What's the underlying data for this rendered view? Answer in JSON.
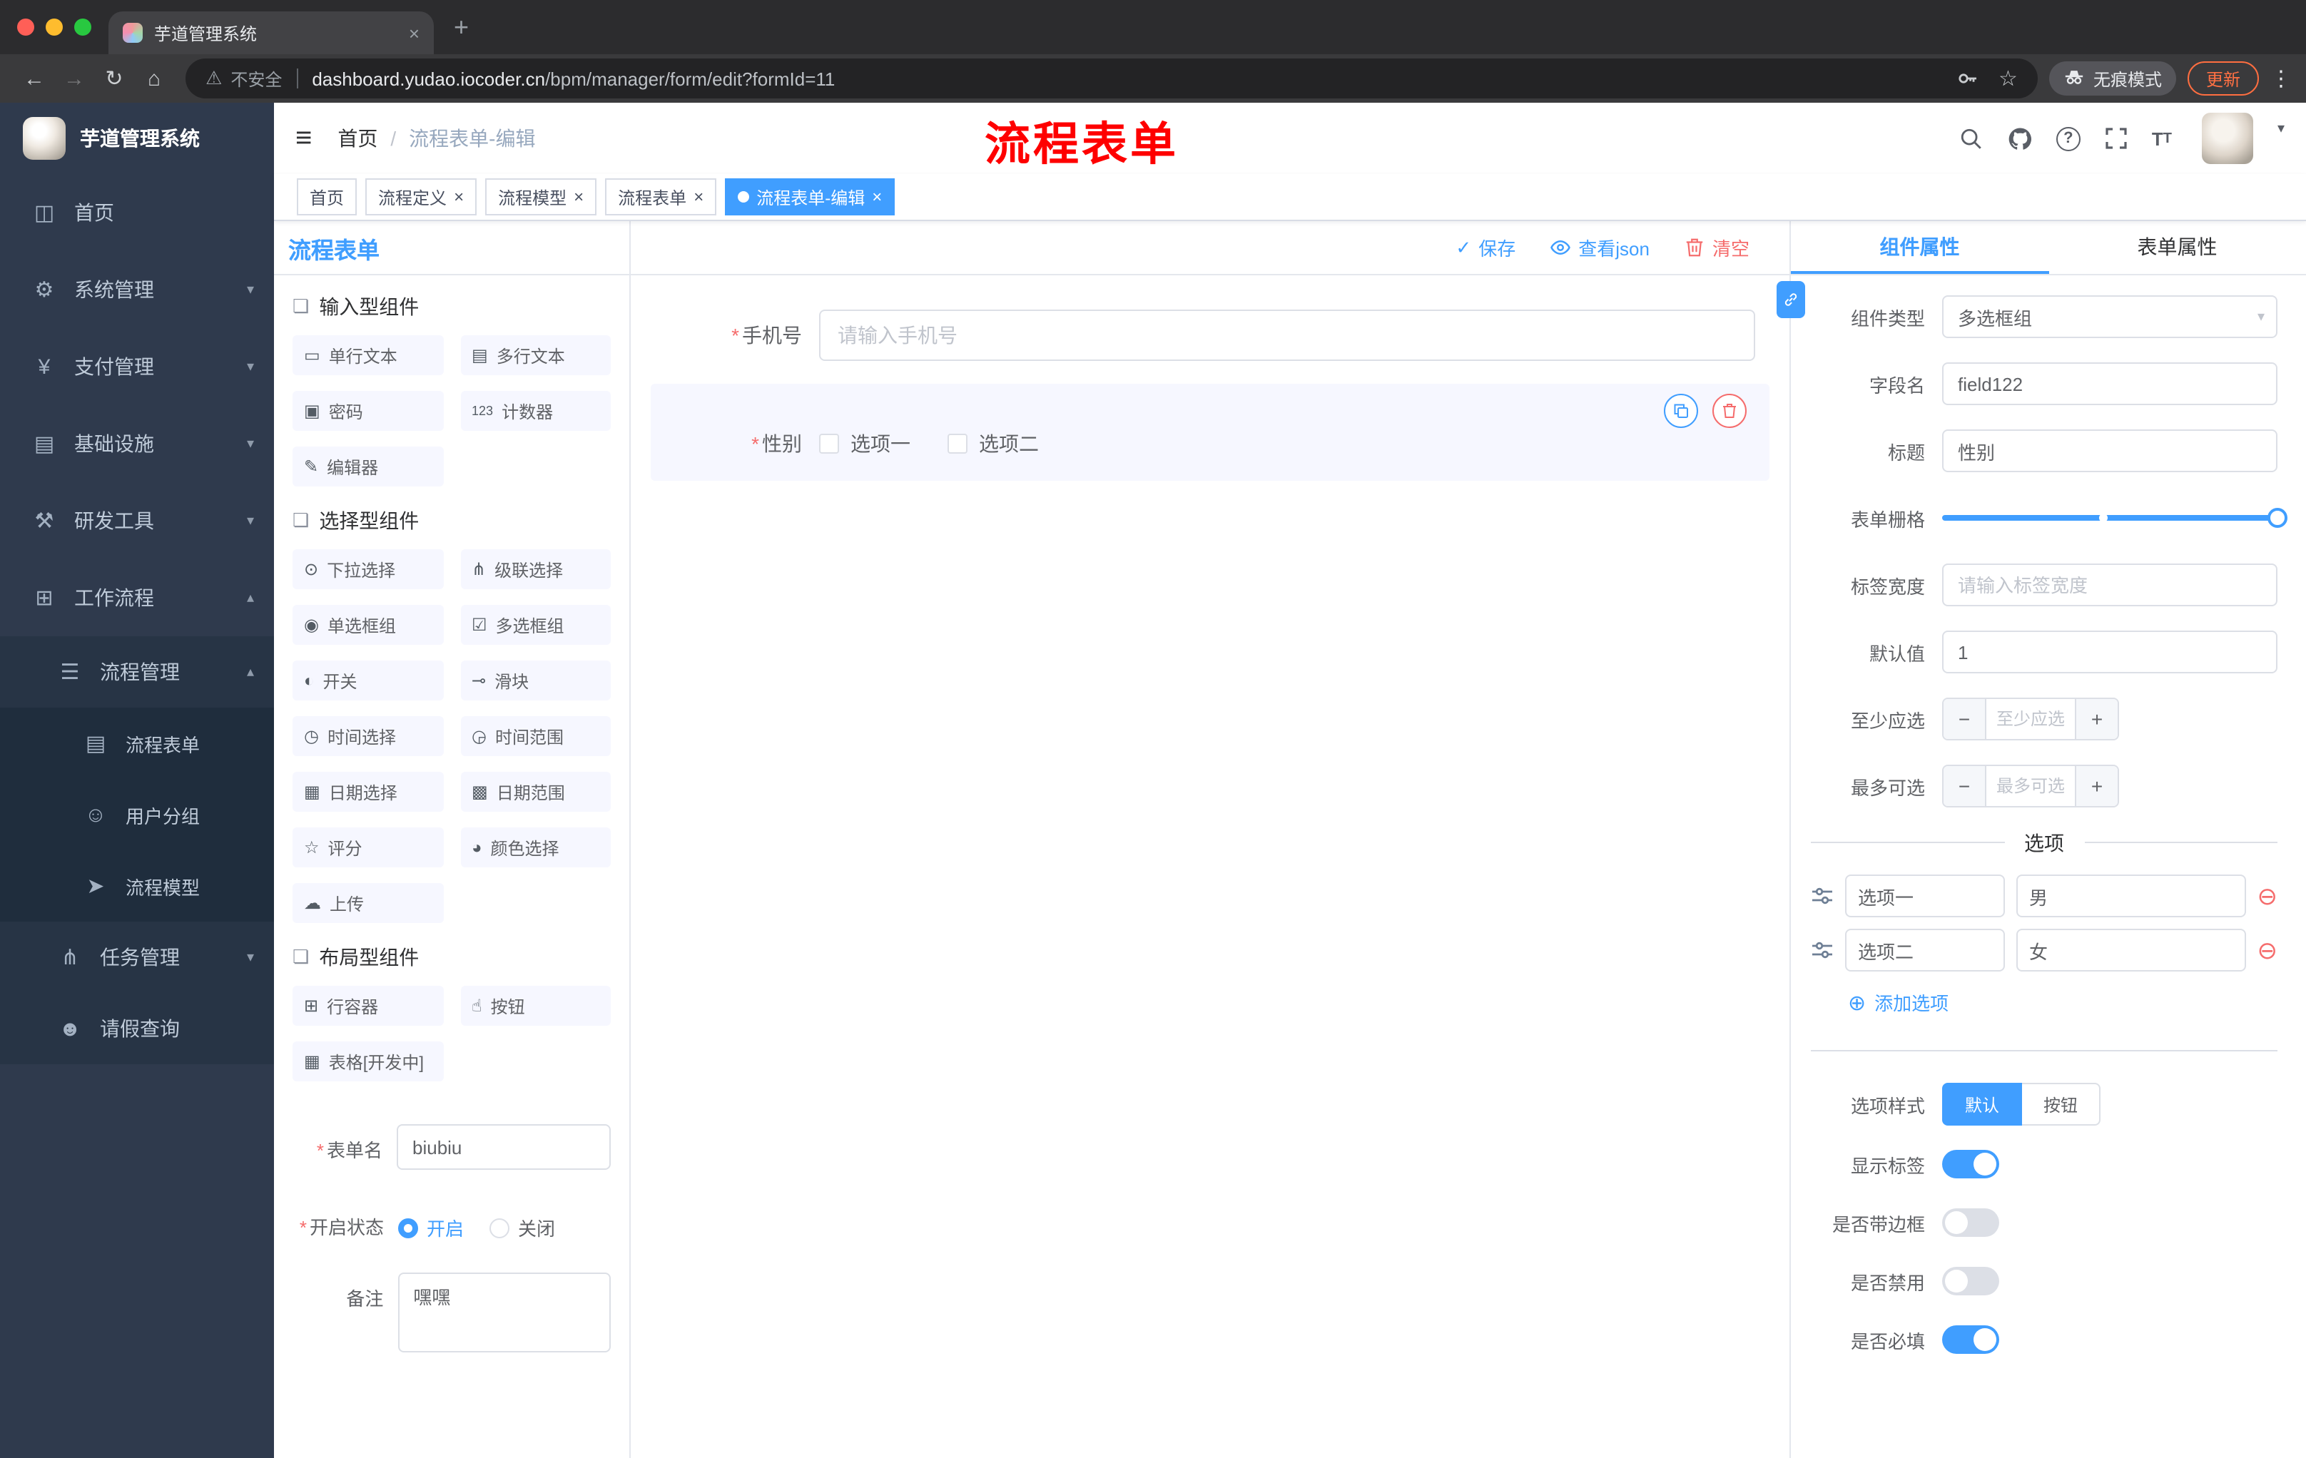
{
  "misc": {
    "required_mark": "*"
  },
  "browser": {
    "tab_title": "芋道管理系统",
    "new_tab": "+",
    "close_tab": "×",
    "back": "←",
    "forward": "→",
    "reload": "↻",
    "home": "⌂",
    "warning_icon": "⚠",
    "security_warning": "不安全",
    "url_domain": "dashboard.yudao.iocoder.cn",
    "url_path": "/bpm/manager/form/edit?formId=11",
    "bookmark_star": "☆",
    "incognito_label": "无痕模式",
    "update_label": "更新",
    "menu_dots": "⋮"
  },
  "sidebar": {
    "logo_title": "芋道管理系统",
    "items": [
      {
        "label": "首页",
        "icon": "◫",
        "chevron": ""
      },
      {
        "label": "系统管理",
        "icon": "⚙",
        "chevron": "▾"
      },
      {
        "label": "支付管理",
        "icon": "¥",
        "chevron": "▾"
      },
      {
        "label": "基础设施",
        "icon": "▤",
        "chevron": "▾"
      },
      {
        "label": "研发工具",
        "icon": "⚒",
        "chevron": "▾"
      },
      {
        "label": "工作流程",
        "icon": "⊞",
        "chevron": "▴"
      },
      {
        "label": "流程管理",
        "icon": "☰",
        "chevron": "▴"
      },
      {
        "label": "流程表单",
        "icon": "▤",
        "chevron": ""
      },
      {
        "label": "用户分组",
        "icon": "☺",
        "chevron": ""
      },
      {
        "label": "流程模型",
        "icon": "➤",
        "chevron": ""
      },
      {
        "label": "任务管理",
        "icon": "⋔",
        "chevron": "▾"
      },
      {
        "label": "请假查询",
        "icon": "☻",
        "chevron": ""
      }
    ]
  },
  "header": {
    "hamburger": "≡",
    "breadcrumb_home": "首页",
    "breadcrumb_sep": "/",
    "breadcrumb_current": "流程表单-编辑",
    "annotation": "流程表单",
    "help": "?",
    "font_icon_big": "T",
    "font_icon_small": "T",
    "avatar_caret": "▾"
  },
  "tags": {
    "close": "×",
    "items": [
      {
        "label": "首页",
        "closable": false,
        "active": false
      },
      {
        "label": "流程定义",
        "closable": true,
        "active": false
      },
      {
        "label": "流程模型",
        "closable": true,
        "active": false
      },
      {
        "label": "流程表单",
        "closable": true,
        "active": false
      },
      {
        "label": "流程表单-编辑",
        "closable": true,
        "active": true
      }
    ]
  },
  "designer": {
    "panel_title": "流程表单",
    "toolbar": {
      "save_icon": "✓",
      "save": "保存",
      "view_json": "查看json",
      "clear": "清空"
    },
    "groups": [
      {
        "title": "输入型组件",
        "icon": "❏",
        "items": [
          {
            "icon": "▭",
            "label": "单行文本"
          },
          {
            "icon": "▤",
            "label": "多行文本"
          },
          {
            "icon": "▣",
            "label": "密码"
          },
          {
            "icon": "123",
            "label": "计数器"
          },
          {
            "icon": "✎",
            "label": "编辑器"
          }
        ]
      },
      {
        "title": "选择型组件",
        "icon": "❏",
        "items": [
          {
            "icon": "⊙",
            "label": "下拉选择"
          },
          {
            "icon": "⋔",
            "label": "级联选择"
          },
          {
            "icon": "◉",
            "label": "单选框组"
          },
          {
            "icon": "☑",
            "label": "多选框组"
          },
          {
            "icon": "◐",
            "label": "开关"
          },
          {
            "icon": "⊸",
            "label": "滑块"
          },
          {
            "icon": "◷",
            "label": "时间选择"
          },
          {
            "icon": "◶",
            "label": "时间范围"
          },
          {
            "icon": "▦",
            "label": "日期选择"
          },
          {
            "icon": "▩",
            "label": "日期范围"
          },
          {
            "icon": "☆",
            "label": "评分"
          },
          {
            "icon": "◕",
            "label": "颜色选择"
          },
          {
            "icon": "☁",
            "label": "上传"
          }
        ]
      },
      {
        "title": "布局型组件",
        "icon": "❏",
        "items": [
          {
            "icon": "⊞",
            "label": "行容器"
          },
          {
            "icon": "☝",
            "label": "按钮"
          },
          {
            "icon": "▦",
            "label": "表格[开发中]"
          }
        ]
      }
    ],
    "meta": {
      "name_label": "表单名",
      "name_value": "biubiu",
      "status_label": "开启状态",
      "status_on": "开启",
      "status_on_selected": true,
      "status_off": "关闭",
      "remark_label": "备注",
      "remark_value": "嘿嘿"
    },
    "canvas": {
      "phone_label": "手机号",
      "phone_placeholder": "请输入手机号",
      "gender_label": "性别",
      "gender_option1": "选项一",
      "gender_option2": "选项二"
    }
  },
  "properties": {
    "tab_component": "组件属性",
    "tab_form": "表单属性",
    "caret": "▾",
    "rows": {
      "type_label": "组件类型",
      "type_value": "多选框组",
      "field_label": "字段名",
      "field_value": "field122",
      "title_label": "标题",
      "title_value": "性别",
      "grid_label": "表单栅格",
      "width_label": "标签宽度",
      "width_placeholder": "请输入标签宽度",
      "default_label": "默认值",
      "default_value": "1",
      "min_label": "至少应选",
      "min_placeholder": "至少应选",
      "max_label": "最多可选",
      "max_placeholder": "最多可选"
    },
    "stepper": {
      "minus": "−",
      "plus": "+"
    },
    "options": {
      "divider": "选项",
      "items": [
        {
          "name": "选项一",
          "value": "男"
        },
        {
          "name": "选项二",
          "value": "女"
        }
      ],
      "remove_icon": "⊖",
      "add_icon": "⊕",
      "add_label": "添加选项"
    },
    "style_row": {
      "label": "选项样式",
      "options": [
        "默认",
        "按钮"
      ],
      "default_active": true
    },
    "switches": [
      {
        "label": "显示标签",
        "on": true
      },
      {
        "label": "是否带边框",
        "on": false
      },
      {
        "label": "是否禁用",
        "on": false
      },
      {
        "label": "是否必填",
        "on": true
      }
    ]
  },
  "colors": {
    "primary": "#409eff",
    "danger": "#f56c6c",
    "annotation": "#fe0000",
    "sidebar_bg": "#2f3a4d",
    "component_btn_bg": "#f6f7ff"
  }
}
